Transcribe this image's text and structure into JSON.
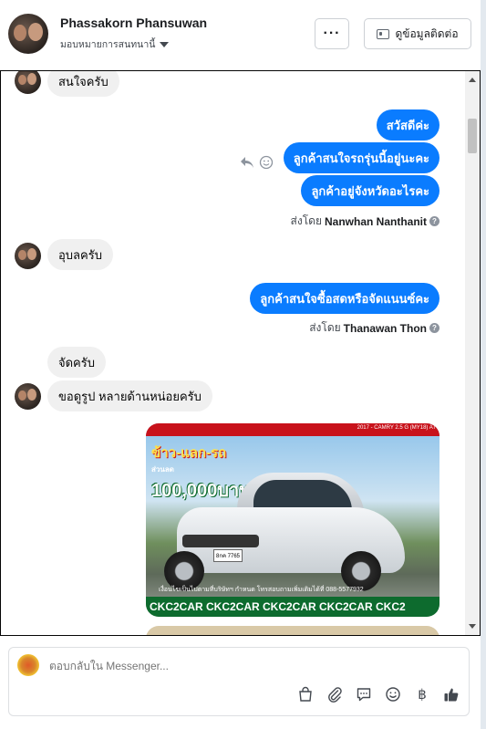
{
  "header": {
    "name": "Phassakorn Phansuwan",
    "assign_label": "มอบหมายการสนทนานี้",
    "more_label": "···",
    "contact_label": "ดูข้อมูลติดต่อ"
  },
  "messages": {
    "m1": "สนใจครับ",
    "m2": "สวัสดีค่ะ",
    "m3": "ลูกค้าสนใจรถรุ่นนี้อยู่นะคะ",
    "m4": "ลูกค้าอยู่จังหวัดอะไรคะ",
    "sent_by_1_prefix": "ส่งโดย",
    "sent_by_1_name": "Nanwhan Nanthanit",
    "m5": "อุบลครับ",
    "m6": "ลูกค้าสนใจซื้อสดหรือจัดแนนซ์คะ",
    "sent_by_2_prefix": "ส่งโดย",
    "sent_by_2_name": "Thanawan Thon",
    "m7": "จัดครับ",
    "m8": "ขอดูรูป หลายด้านหน่อยครับ"
  },
  "image": {
    "promo_top": "ข้าว-แลก-รถ",
    "promo_discount": "ส่วนลด",
    "promo_amount": "100,000บาท",
    "model_text": "2017 - CAMRY 2.5 G (MY18) AT",
    "plate_text": "8กค 7765",
    "caption": "เงื่อนไขเป็นไปตามที่บริษัทฯ กำหนด โทรสอบถามเพิ่มเติมได้ที่ 088-5577932",
    "banner_text": "CKC2CAR CKC2CAR CKC2CAR CKC2CAR CKC2"
  },
  "composer": {
    "placeholder": "ตอบกลับใน Messenger..."
  },
  "icons": {
    "bag": "shopping-bag-icon",
    "attach": "paperclip-icon",
    "saved_reply": "saved-reply-icon",
    "emoji": "emoji-icon",
    "currency": "baht-icon",
    "like": "thumbs-up-icon"
  },
  "colors": {
    "outgoing_bubble": "#0a7cff",
    "incoming_bubble": "#f0f0f0"
  }
}
